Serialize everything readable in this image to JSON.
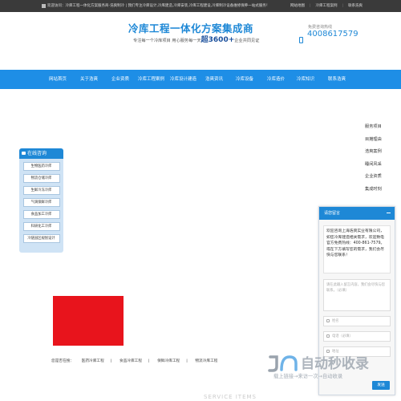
{
  "topbar": {
    "notice": "欢迎访问：冷库工程一体化方案服务商-浩爽制冷 | 我们专注冷库设计,冷库建造,冷库安装,冷库工程建设,冷库制冷设备维修保养一站式服务！",
    "links": [
      "网站地图",
      "冷库工程案例",
      "联系浩爽"
    ]
  },
  "header": {
    "title": "冷库工程一体化方案集成商",
    "slogan_prefix": "专注每一个冷库项目  用心服务每一天",
    "slogan_highlight": "超3600+",
    "slogan_suffix": "企业共同见证",
    "hotline_label": "免费咨询热线",
    "hotline": "4008617579"
  },
  "nav": [
    "网站首页",
    "关于浩爽",
    "企业资质",
    "冷库工程案例",
    "冷库设计建造",
    "浩爽资讯",
    "冷库设备",
    "冷库造价",
    "冷库知识",
    "联系浩爽"
  ],
  "sidelist": [
    "服务项目",
    "目摊理由",
    "浩爽案例",
    "睡间风采",
    "企业资质",
    "集成时刻"
  ],
  "consult": {
    "title": "在线咨询",
    "buttons": [
      "生物医药冷库",
      "物流仓储冷库",
      "生鲜冷冻冷库",
      "气调保鲜冷库",
      "食品加工冷库",
      "科研化工冷库",
      "冷链园区规划设计"
    ]
  },
  "breadcrumb": {
    "prefix": "您是否在搜：",
    "items": [
      "医药冷库工程",
      "食品冷库工程",
      "保鲜冷库工程",
      "物流冷库工程"
    ]
  },
  "service_title": "SERVICE ITEMS",
  "chat": {
    "title": "请您留言",
    "message": "欢迎咨询上海浩爽实业有限公司，如您冷库建造相关需求，欢迎致电官方免费热线：400-861-7579。或在下方填写您的需求，我们会尽快与您联系！",
    "textarea_placeholder": "请在此输入留言内容，我们会尽快与您联系。（必填）",
    "name_placeholder": "姓名",
    "phone_placeholder": "电话（必填）",
    "address_placeholder": "地址",
    "send_label": "发送"
  },
  "watermark": {
    "text": "自动秒收录",
    "sub": "载上链接→来访一次→自动收录"
  }
}
